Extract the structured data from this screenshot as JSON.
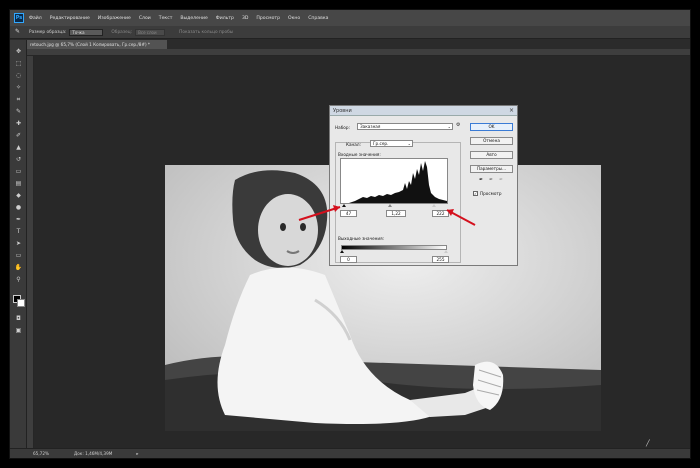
{
  "menubar": {
    "logo": "Ps",
    "items": [
      "Файл",
      "Редактирование",
      "Изображение",
      "Слои",
      "Текст",
      "Выделение",
      "Фильтр",
      "3D",
      "Просмотр",
      "Окно",
      "Справка"
    ]
  },
  "options": {
    "sample_size_label": "Размер образца:",
    "sample_size_value": "Точка",
    "sample_label": "Образец:",
    "sample_value": "Все слои",
    "show_ring_label": "Показать кольцо пробы"
  },
  "document_tab": {
    "title": "retouch.jpg @ 65,7% (Слой 1 Копировать, Гр.сер./8#) *"
  },
  "status": {
    "zoom": "65,72%",
    "doc_info": "Док: 1,46M/4,39M"
  },
  "levels_dialog": {
    "title": "Уровни",
    "preset_label": "Набор:",
    "preset_value": "Заказная",
    "channel_label": "Канал:",
    "channel_value": "Гр.сер.",
    "input_levels_label": "Входные значения:",
    "input_black": "47",
    "input_gamma": "1,22",
    "input_white": "222",
    "output_levels_label": "Выходные значения:",
    "output_black": "0",
    "output_white": "255",
    "ok": "OK",
    "cancel": "Отмена",
    "auto": "Авто",
    "options": "Параметры...",
    "preview_label": "Просмотр",
    "preview_checked": true
  },
  "colors": {
    "app_bg": "#2b2b2b",
    "arrow": "#d4101d",
    "ok_border": "#3a7bd5"
  }
}
